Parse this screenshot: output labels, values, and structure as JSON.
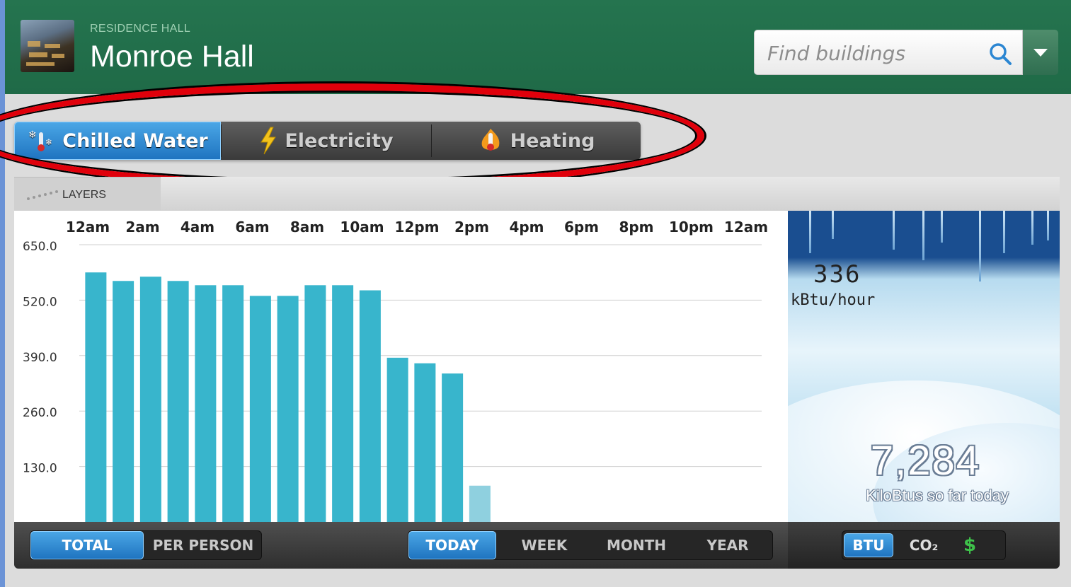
{
  "header": {
    "subtitle": "RESIDENCE HALL",
    "title": "Monroe Hall",
    "search_placeholder": "Find buildings"
  },
  "tabs": [
    {
      "label": "Chilled Water",
      "icon": "snowflake-thermometer-icon",
      "active": true
    },
    {
      "label": "Electricity",
      "icon": "lightning-bolt-icon",
      "active": false
    },
    {
      "label": "Heating",
      "icon": "flame-thermometer-icon",
      "active": false
    }
  ],
  "layers_label": "LAYERS",
  "chart_data": {
    "type": "bar",
    "x_tick_labels": [
      "12am",
      "2am",
      "4am",
      "6am",
      "8am",
      "10am",
      "12pm",
      "2pm",
      "4pm",
      "6pm",
      "8pm",
      "10pm",
      "12am"
    ],
    "y_tick_labels": [
      "650.0",
      "520.0",
      "390.0",
      "260.0",
      "130.0"
    ],
    "ylim": [
      0,
      650
    ],
    "values": [
      585,
      565,
      575,
      565,
      555,
      555,
      530,
      530,
      555,
      555,
      543,
      385,
      372,
      348,
      85
    ],
    "highlight_last": true,
    "bar_color": "#38b5cc",
    "last_bar_color": "#8fd0df",
    "grid": true
  },
  "readout": {
    "current_value": "336",
    "current_unit": "kBtu/hour",
    "total_value": "7,284",
    "total_label": "KiloBtus so far today"
  },
  "controls": {
    "mode": [
      {
        "label": "TOTAL",
        "active": true
      },
      {
        "label": "PER PERSON",
        "active": false
      }
    ],
    "period": [
      {
        "label": "TODAY",
        "active": true
      },
      {
        "label": "WEEK",
        "active": false
      },
      {
        "label": "MONTH",
        "active": false
      },
      {
        "label": "YEAR",
        "active": false
      }
    ],
    "unit": [
      {
        "label": "BTU",
        "active": true
      },
      {
        "label": "CO₂",
        "active": false
      },
      {
        "label": "$",
        "active": false
      }
    ]
  },
  "colors": {
    "header_green": "#23704c",
    "active_blue": "#2b86d2",
    "annotation_red": "#e0000b"
  }
}
